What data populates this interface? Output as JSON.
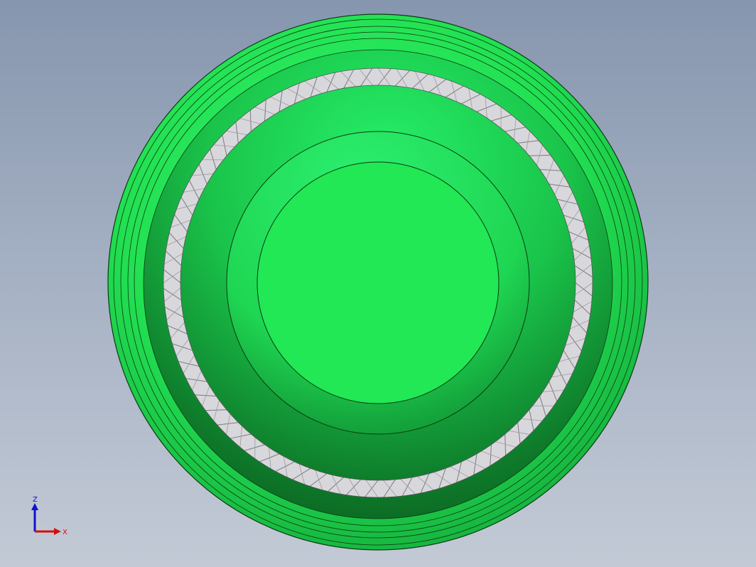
{
  "viewport": {
    "background_top": "#8696ae",
    "background_bottom": "#c3cad6"
  },
  "model": {
    "part_color": "#22ee55",
    "part_shadow_color": "#0a5a1c",
    "spring_color": "#d8d8dc",
    "edge_color": "#000000"
  },
  "triad": {
    "z_label": "Z",
    "x_label": "X",
    "z_color": "#1010d0",
    "x_color": "#d01010"
  }
}
